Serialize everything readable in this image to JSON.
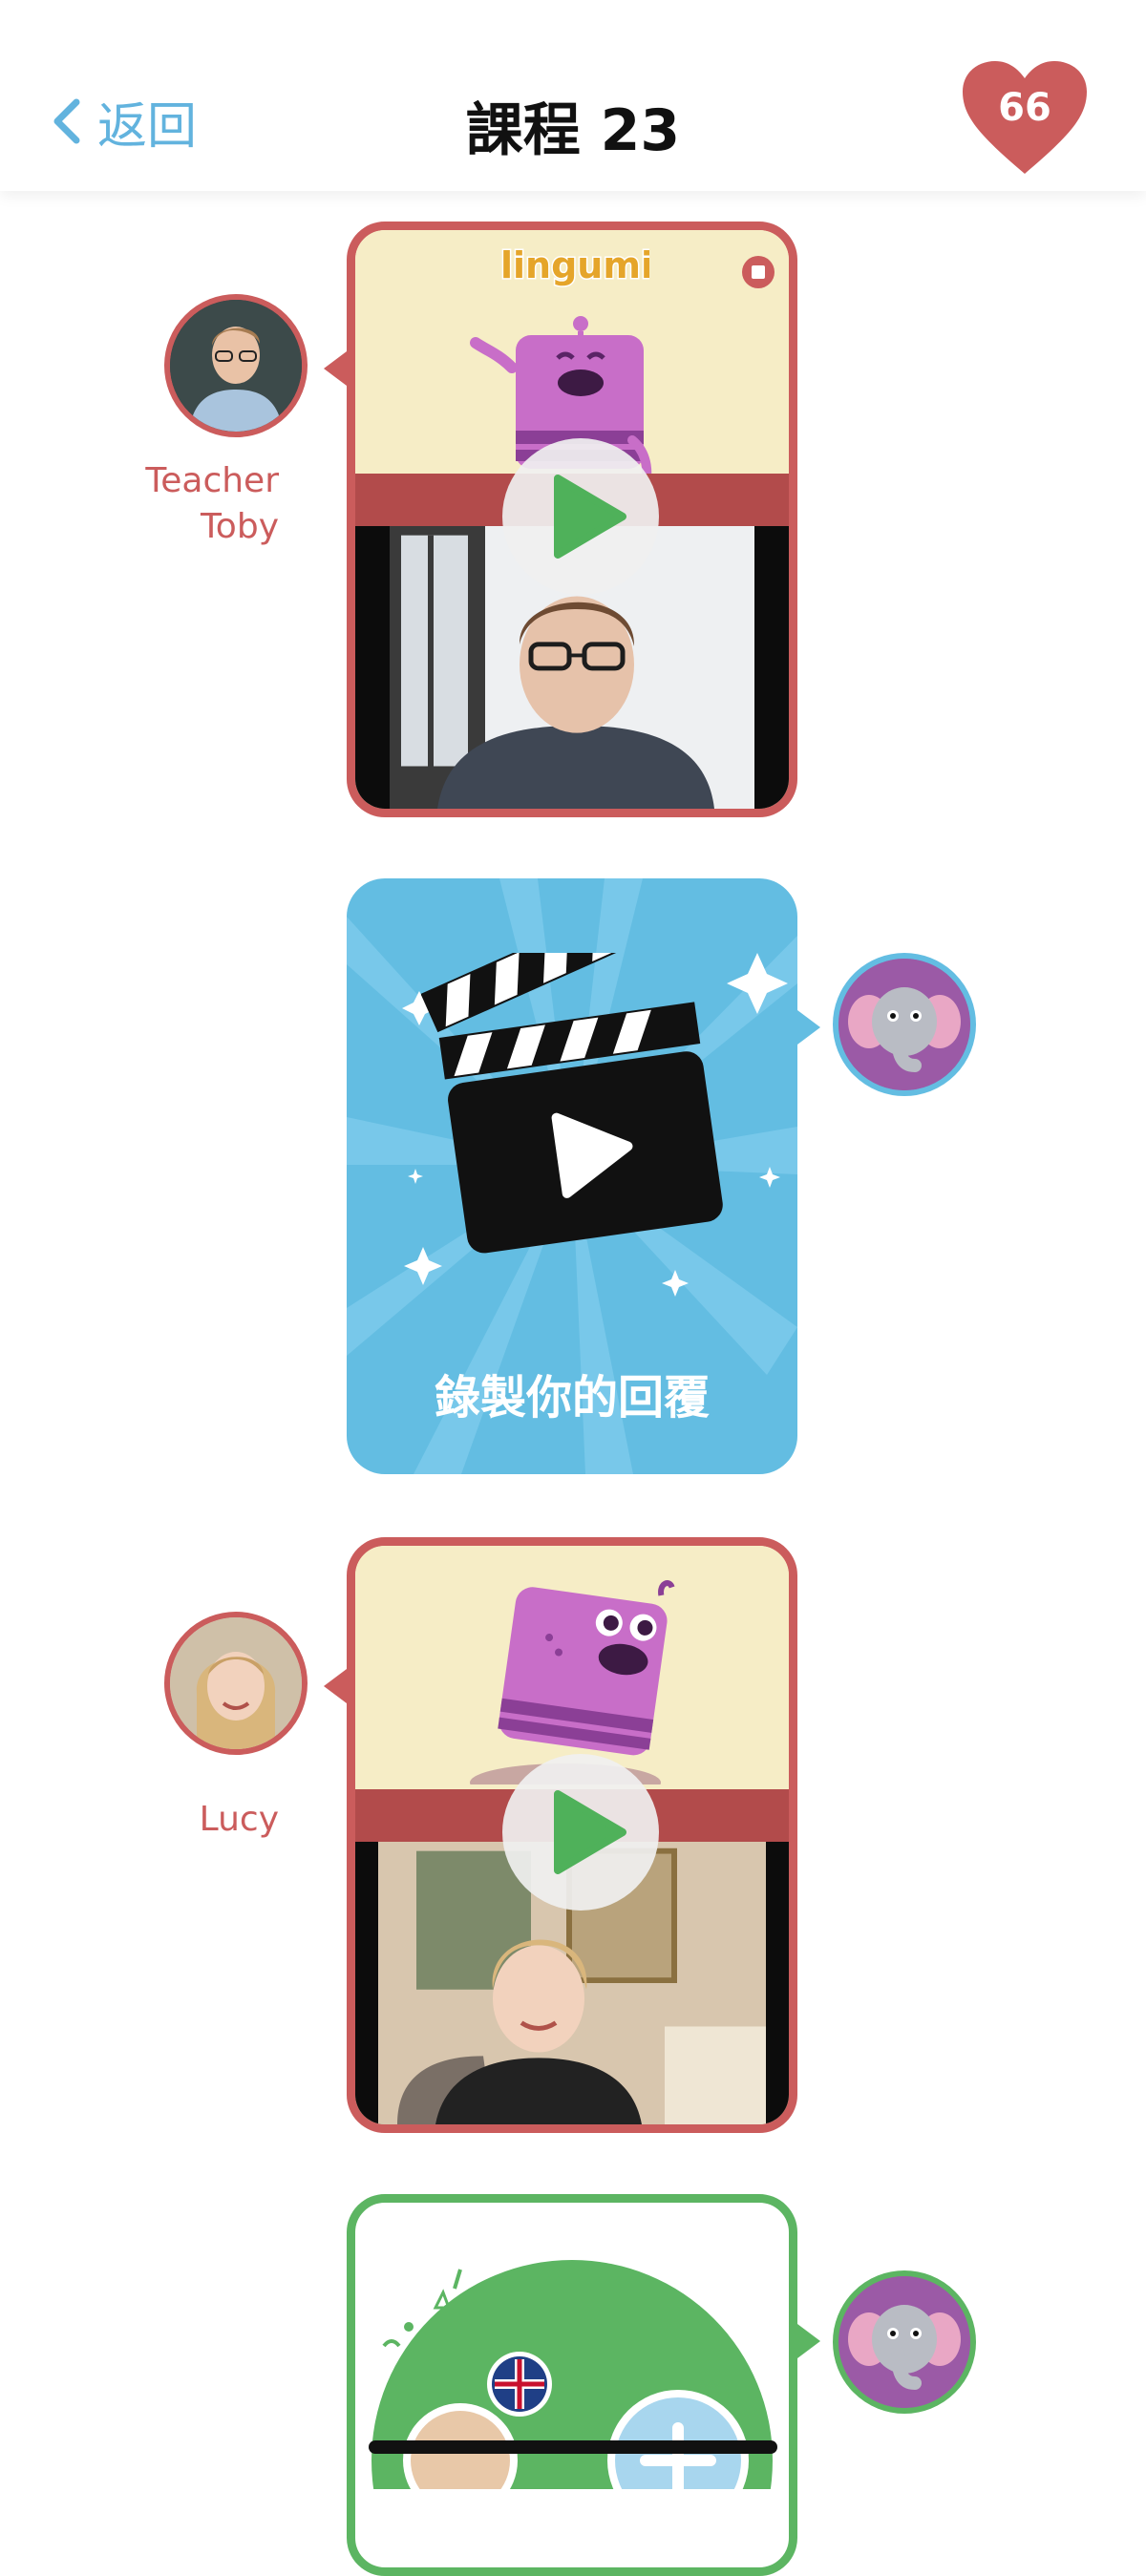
{
  "header": {
    "back_label": "返回",
    "title": "課程 23",
    "hearts_count": "66"
  },
  "messages": [
    {
      "sender": "Teacher Toby",
      "sender_line1": "Teacher",
      "sender_line2": "Toby",
      "type": "video",
      "brand": "lingumi"
    },
    {
      "type": "record",
      "label": "錄製你的回覆"
    },
    {
      "sender": "Lucy",
      "type": "video"
    },
    {
      "type": "add-card"
    }
  ],
  "colors": {
    "accent_blue": "#63bde2",
    "teacher_red": "#cb5c5c",
    "green": "#5cb562",
    "cream": "#f6edc6",
    "heart": "#cb5c5c"
  }
}
